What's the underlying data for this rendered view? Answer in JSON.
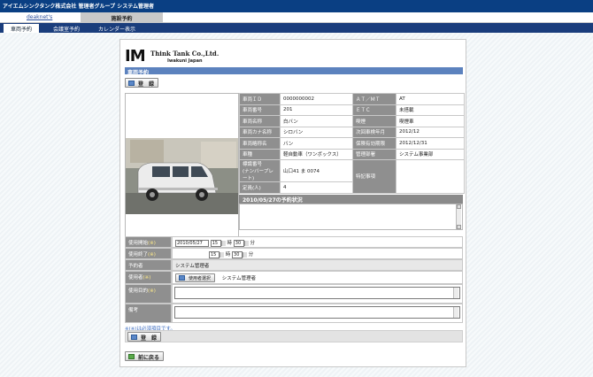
{
  "app_title": "アイエムシンクタンク株式会社 管理者グループ システム管理者",
  "topnav": {
    "link": "deaknet's",
    "current": "施設予約"
  },
  "tabs": [
    {
      "label": "車両予約",
      "active": true
    },
    {
      "label": "会議室予約",
      "active": false
    },
    {
      "label": "カレンダー表示",
      "active": false
    }
  ],
  "logo": {
    "mark": "IM",
    "company": "Think Tank Co.,Ltd.",
    "sub": "Iwakuni Japan"
  },
  "section_title": "車両予約",
  "register_label": "登　録",
  "vehicle": {
    "rows": [
      {
        "k1": "車両ＩＤ",
        "v1": "0000000002",
        "k2": "ＡＴ／ＭＴ",
        "v2": "AT"
      },
      {
        "k1": "車両番号",
        "v1": "201",
        "k2": "ＥＴＣ",
        "v2": "未搭載"
      },
      {
        "k1": "車両名称",
        "v1": "白バン",
        "k2": "喫煙",
        "v2": "喫煙車"
      },
      {
        "k1": "車両カナ名称",
        "v1": "シロバン",
        "k2": "次回車検年月",
        "v2": "2012/12"
      },
      {
        "k1": "車両略称名",
        "v1": "バン",
        "k2": "保険有効期限",
        "v2": "2012/12/31"
      },
      {
        "k1": "車種",
        "v1": "軽自動車（ワンボックス）",
        "k2": "管理部署",
        "v2": "システム事業部"
      },
      {
        "k1": "標識番号\n(ナンバープレート)",
        "v1": "山口41 ま 0074",
        "k2": "特記事項",
        "v2": ""
      },
      {
        "k1": "定員(人)",
        "v1": "4",
        "k2": "",
        "v2": ""
      }
    ]
  },
  "status_title": "2010/05/27の予約状況",
  "form": {
    "start_label": "使用開始",
    "start_date": "2010/05/27",
    "start_hour": "15",
    "start_min": "30",
    "end_label": "使用終了",
    "end_hour": "15",
    "end_min": "30",
    "hour_unit": "時",
    "min_unit": "分",
    "req_mark": "(※)",
    "booker_label": "予約者",
    "booker_value": "システム管理者",
    "user_label": "使用者",
    "user_select_label": "使用者選択",
    "user_value": "システム管理者",
    "purpose_label": "使用目的",
    "remarks_label": "備考",
    "required_note": "※(※)は必須項目です。"
  },
  "back_label": "前に戻る",
  "colors": {
    "title_bar": "#0a3f83",
    "section_head": "#5c82be",
    "label_bg": "#8f8f8f"
  }
}
